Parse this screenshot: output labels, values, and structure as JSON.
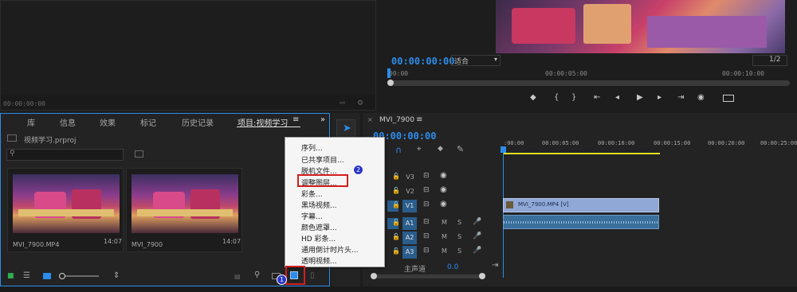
{
  "source_monitor": {
    "timecode": "00:00:00:00"
  },
  "program_monitor": {
    "timecode": "00:00:00:00",
    "fit": "适合",
    "resolution": "1/2",
    "ruler": [
      "00:00",
      "00:00:05:00",
      "00:00:10:00"
    ]
  },
  "project_panel": {
    "tabs": [
      "库",
      "信息",
      "效果",
      "标记",
      "历史记录",
      "项目:视频学习"
    ],
    "project_file": "视频学习.prproj",
    "clips": [
      {
        "name": "MVI_7900.MP4",
        "duration": "14:07"
      },
      {
        "name": "MVI_7900",
        "duration": "14:07"
      }
    ]
  },
  "context_menu": {
    "items": [
      "序列...",
      "已共享项目...",
      "脱机文件...",
      "调整图层...",
      "彩条...",
      "黑场视频...",
      "字幕...",
      "颜色遮罩...",
      "HD 彩条...",
      "通用倒计时片头...",
      "透明视频..."
    ]
  },
  "timeline": {
    "sequence": "MVI_7900",
    "timecode": "00:00:00:00",
    "ruler": [
      ":00:00",
      "00:00:05:00",
      "00:00:10:00",
      "00:00:15:00",
      "00:00:20:00",
      "00:00:25:00"
    ],
    "video_tracks": [
      "V3",
      "V2",
      "V1"
    ],
    "audio_tracks": [
      "A1",
      "A2",
      "A3"
    ],
    "master_label": "主声道",
    "master_value": "0.0",
    "clip_label": "MVI_7900.MP4 [V]"
  },
  "badges": [
    "1",
    "2"
  ],
  "colors": {
    "accent": "#2d8ceb",
    "track_active": "#2a5d8c",
    "clip_video": "#8fa8d6",
    "clip_audio": "#3a6f9c",
    "highlight": "#d21e1e"
  }
}
